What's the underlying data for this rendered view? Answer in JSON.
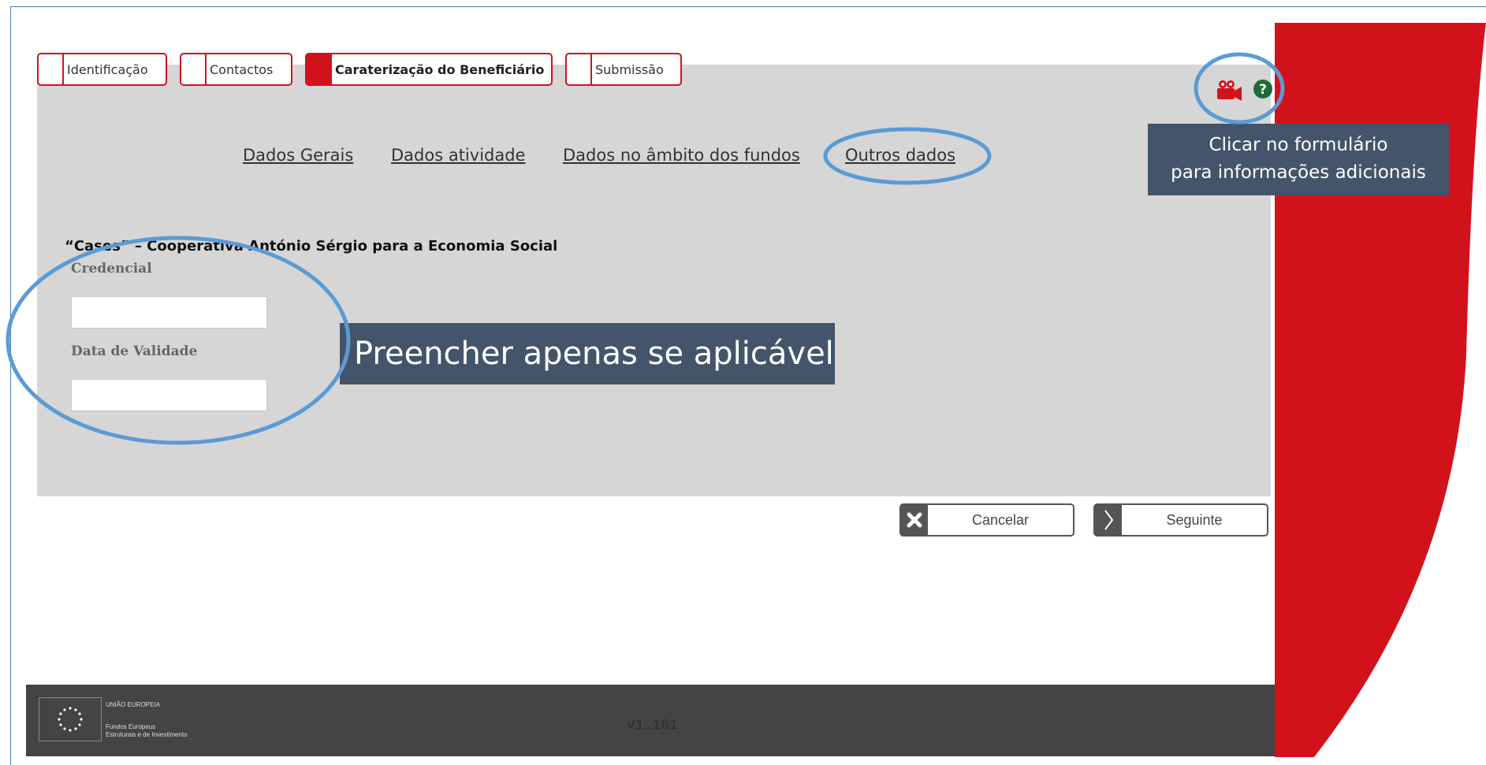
{
  "tabs": [
    {
      "label": "Identificação",
      "active": false
    },
    {
      "label": "Contactos",
      "active": false
    },
    {
      "label": "Caraterização do Beneficiário",
      "active": true
    },
    {
      "label": "Submissão",
      "active": false
    }
  ],
  "subnav": [
    "Dados Gerais",
    "Dados atividade",
    "Dados no âmbito dos fundos",
    "Outros dados"
  ],
  "organization": "“Cases” – Cooperativa António Sérgio para a Economia Social",
  "form": {
    "credential_label": "Credencial",
    "credential_value": "",
    "validity_label": "Data de Validade",
    "validity_value": ""
  },
  "callouts": {
    "main": "Preencher apenas se aplicável",
    "side_line1": "Clicar no formulário",
    "side_line2": "para informações  adicionais"
  },
  "toolbar_icons": [
    "video-camera-icon",
    "help-icon"
  ],
  "buttons": {
    "cancel": "Cancelar",
    "next": "Seguinte"
  },
  "footer": {
    "eu_line": "UNIÃO EUROPEIA",
    "funds_line1": "Fundos Europeus",
    "funds_line2": "Estruturais e de Investimento",
    "version": "v1.161"
  },
  "colors": {
    "brand_red": "#d2121b",
    "callout": "#44546a",
    "highlight_ring": "#5b9bd5",
    "content_bg": "#d6d6d6",
    "footer_bg": "#444444",
    "help_green": "#1e6b35"
  }
}
